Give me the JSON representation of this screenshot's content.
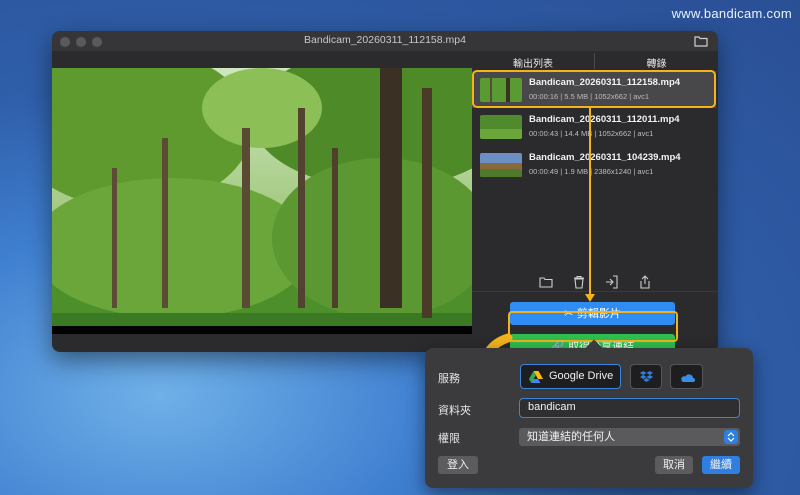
{
  "watermark": "www.bandicam.com",
  "window": {
    "title": "Bandicam_20260311_112158.mp4"
  },
  "tabs": [
    {
      "label": "輸出列表"
    },
    {
      "label": "轉錄"
    }
  ],
  "files": [
    {
      "name": "Bandicam_20260311_112158.mp4",
      "meta": "00:00:16 | 5.5 MB | 1052x662 | avc1"
    },
    {
      "name": "Bandicam_20260311_112011.mp4",
      "meta": "00:00:43 | 14.4 MB | 1052x662 | avc1"
    },
    {
      "name": "Bandicam_20260311_104239.mp4",
      "meta": "00:00:49 | 1.9 MB | 2386x1240 | avc1"
    }
  ],
  "buttons": {
    "edit": "剪輯影片",
    "share": "取得分享連結"
  },
  "popover": {
    "service_label": "服務",
    "google_drive": "Google Drive",
    "folder_label": "資料夾",
    "folder_value": "bandicam",
    "permission_label": "權限",
    "permission_value": "知道連結的任何人",
    "login": "登入",
    "cancel": "取消",
    "continue": "繼續"
  },
  "colors": {
    "accent_blue": "#2f8cf3",
    "accent_green": "#2ebf4f",
    "highlight": "#f5b31a"
  }
}
